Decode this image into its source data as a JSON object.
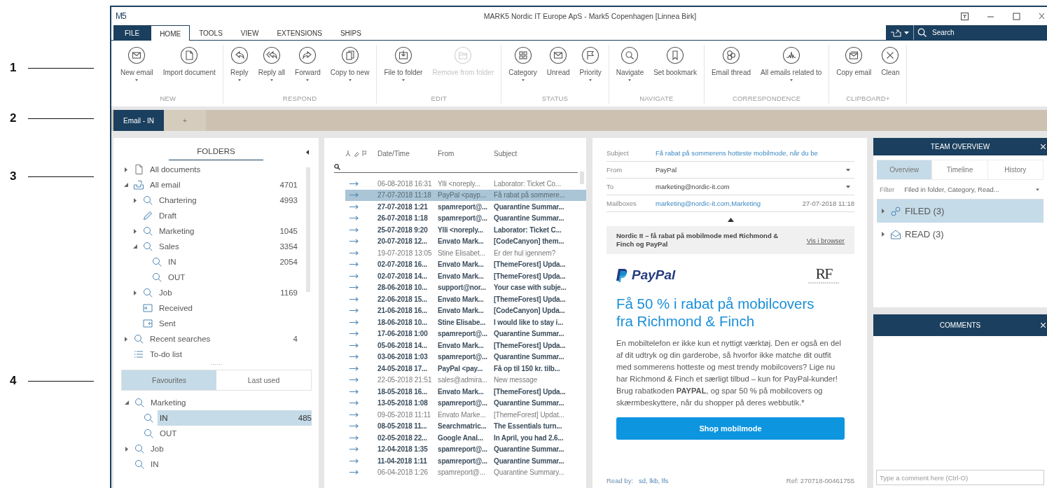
{
  "annotations": [
    {
      "label": "1"
    },
    {
      "label": "2"
    },
    {
      "label": "3"
    },
    {
      "label": "4"
    }
  ],
  "window": {
    "logo": "M5",
    "title": "MARK5 Nordic IT Europe ApS - Mark5 Copenhagen [Linnea Birk]"
  },
  "menu": [
    {
      "label": "FILE",
      "kind": "file",
      "selected": false
    },
    {
      "label": "HOME",
      "kind": "tab",
      "selected": true
    },
    {
      "label": "TOOLS",
      "kind": "tab",
      "selected": false
    },
    {
      "label": "VIEW",
      "kind": "tab",
      "selected": false
    },
    {
      "label": "EXTENSIONS",
      "kind": "tab",
      "selected": false
    },
    {
      "label": "SHIPS",
      "kind": "tab",
      "selected": false
    }
  ],
  "search": {
    "placeholder": "Search"
  },
  "ribbon": [
    {
      "group": "NEW",
      "buttons": [
        {
          "label": "New email",
          "dropdown": true,
          "disabled": false
        },
        {
          "label": "Import document",
          "dropdown": false,
          "disabled": false
        }
      ]
    },
    {
      "group": "RESPOND",
      "buttons": [
        {
          "label": "Reply",
          "dropdown": true,
          "disabled": false
        },
        {
          "label": "Reply all",
          "dropdown": true,
          "disabled": false
        },
        {
          "label": "Forward",
          "dropdown": true,
          "disabled": false
        },
        {
          "label": "Copy to new",
          "dropdown": true,
          "disabled": false
        }
      ]
    },
    {
      "group": "EDIT",
      "buttons": [
        {
          "label": "File to folder",
          "dropdown": true,
          "disabled": false
        },
        {
          "label": "Remove from folder",
          "dropdown": false,
          "disabled": true
        }
      ]
    },
    {
      "group": "STATUS",
      "buttons": [
        {
          "label": "Category",
          "dropdown": true,
          "disabled": false
        },
        {
          "label": "Unread",
          "dropdown": false,
          "disabled": false
        },
        {
          "label": "Priority",
          "dropdown": true,
          "disabled": false
        }
      ]
    },
    {
      "group": "NAVIGATE",
      "buttons": [
        {
          "label": "Navigate",
          "dropdown": true,
          "disabled": false
        },
        {
          "label": "Set bookmark",
          "dropdown": false,
          "disabled": false
        }
      ]
    },
    {
      "group": "CORRESPONDENCE",
      "buttons": [
        {
          "label": "Email thread",
          "dropdown": false,
          "disabled": false
        },
        {
          "label": "All emails related to",
          "dropdown": true,
          "disabled": false
        }
      ]
    },
    {
      "group": "CLIPBOARD+",
      "buttons": [
        {
          "label": "Copy email",
          "dropdown": false,
          "disabled": false
        },
        {
          "label": "Clean",
          "dropdown": false,
          "disabled": false
        }
      ]
    }
  ],
  "doc_tabs": [
    {
      "label": "Email - IN",
      "selected": true
    },
    {
      "label": "+",
      "selected": false
    }
  ],
  "folders": {
    "title": "FOLDERS",
    "items": [
      {
        "label": "All documents",
        "kind": "document",
        "expanded": false
      },
      {
        "label": "All email",
        "kind": "mailbox",
        "count": "4701",
        "expanded": true,
        "children": [
          {
            "label": "Chartering",
            "kind": "search",
            "count": "4993",
            "expanded": false
          },
          {
            "label": "Draft",
            "kind": "draft"
          },
          {
            "label": "Marketing",
            "kind": "search",
            "count": "1045",
            "expanded": false
          },
          {
            "label": "Sales",
            "kind": "search",
            "count": "3354",
            "expanded": true,
            "children": [
              {
                "label": "IN",
                "kind": "search",
                "count": "2054"
              },
              {
                "label": "OUT",
                "kind": "search"
              }
            ]
          },
          {
            "label": "Job",
            "kind": "search",
            "count": "1169",
            "expanded": false
          },
          {
            "label": "Received",
            "kind": "received"
          },
          {
            "label": "Sent",
            "kind": "sent"
          }
        ]
      },
      {
        "label": "Recent searches",
        "kind": "search",
        "count": "4",
        "expanded": false
      },
      {
        "label": "To-do list",
        "kind": "list"
      }
    ],
    "tabs": [
      {
        "label": "Favourites",
        "selected": true
      },
      {
        "label": "Last used",
        "selected": false
      }
    ],
    "favourites": [
      {
        "label": "Marketing",
        "kind": "search",
        "expanded": true,
        "selected": false,
        "children": [
          {
            "label": "IN",
            "kind": "search",
            "count": "485",
            "selected": true
          },
          {
            "label": "OUT",
            "kind": "search",
            "selected": false
          }
        ]
      },
      {
        "label": "Job",
        "kind": "search",
        "expanded": false,
        "selected": false
      },
      {
        "label": "IN",
        "kind": "search",
        "selected": false
      }
    ]
  },
  "mail_list": {
    "columns": [
      "Date/Time",
      "From",
      "Subject"
    ],
    "rows": [
      {
        "date": "06-08-2018 16:31",
        "from": "Ylli <noreply...",
        "subject": "Laborator: Ticket Co...",
        "unread": false,
        "selected": false
      },
      {
        "date": "27-07-2018 11:18",
        "from": "PayPal <payp...",
        "subject": "Få rabat på sommere...",
        "unread": false,
        "selected": true
      },
      {
        "date": "27-07-2018 1:21",
        "from": "spamreport@...",
        "subject": "Quarantine Summar...",
        "unread": true,
        "selected": false
      },
      {
        "date": "26-07-2018 1:18",
        "from": "spamreport@...",
        "subject": "Quarantine Summar...",
        "unread": true,
        "selected": false
      },
      {
        "date": "25-07-2018 9:20",
        "from": "Ylli <noreply...",
        "subject": "Laborator: Ticket C...",
        "unread": true,
        "selected": false
      },
      {
        "date": "20-07-2018 12...",
        "from": "Envato Mark...",
        "subject": "[CodeCanyon] them...",
        "unread": true,
        "selected": false
      },
      {
        "date": "19-07-2018 13:05",
        "from": "Stine Elisabet...",
        "subject": "Er der hul igennem?",
        "unread": false,
        "selected": false
      },
      {
        "date": "02-07-2018 16...",
        "from": "Envato Mark...",
        "subject": "[ThemeForest] Upda...",
        "unread": true,
        "selected": false
      },
      {
        "date": "02-07-2018 14...",
        "from": "Envato Mark...",
        "subject": "[ThemeForest] Upda...",
        "unread": true,
        "selected": false
      },
      {
        "date": "28-06-2018 10...",
        "from": "support@nor...",
        "subject": "Your case with subje...",
        "unread": true,
        "selected": false
      },
      {
        "date": "22-06-2018 15...",
        "from": "Envato Mark...",
        "subject": "[ThemeForest] Upda...",
        "unread": true,
        "selected": false
      },
      {
        "date": "21-06-2018 16...",
        "from": "Envato Mark...",
        "subject": "[CodeCanyon] Upda...",
        "unread": true,
        "selected": false
      },
      {
        "date": "18-06-2018 10...",
        "from": "Stine Elisabe...",
        "subject": "I would like to stay i...",
        "unread": true,
        "selected": false
      },
      {
        "date": "17-06-2018 1:00",
        "from": "spamreport@...",
        "subject": "Quarantine Summar...",
        "unread": true,
        "selected": false
      },
      {
        "date": "05-06-2018 14...",
        "from": "Envato Mark...",
        "subject": "[ThemeForest] Upda...",
        "unread": true,
        "selected": false
      },
      {
        "date": "03-06-2018 1:03",
        "from": "spamreport@...",
        "subject": "Quarantine Summar...",
        "unread": true,
        "selected": false
      },
      {
        "date": "24-05-2018 17...",
        "from": "PayPal <pay...",
        "subject": "Få op til 150 kr. tilb...",
        "unread": true,
        "selected": false
      },
      {
        "date": "22-05-2018 21:51",
        "from": "sales@admira...",
        "subject": "New message",
        "unread": false,
        "selected": false
      },
      {
        "date": "18-05-2018 16...",
        "from": "Envato Mark...",
        "subject": "[ThemeForest] Upda...",
        "unread": true,
        "selected": false
      },
      {
        "date": "13-05-2018 1:08",
        "from": "spamreport@...",
        "subject": "Quarantine Summar...",
        "unread": true,
        "selected": false
      },
      {
        "date": "09-05-2018 11:11",
        "from": "Envato Marke...",
        "subject": "[ThemeForest] Updat...",
        "unread": false,
        "selected": false
      },
      {
        "date": "08-05-2018 11...",
        "from": "Searchmatric...",
        "subject": "The Essentials turn...",
        "unread": true,
        "selected": false
      },
      {
        "date": "02-05-2018 22...",
        "from": "Google Anal...",
        "subject": "In April, you had 2.6...",
        "unread": true,
        "selected": false
      },
      {
        "date": "12-04-2018 1:35",
        "from": "spamreport@...",
        "subject": "Quarantine Summar...",
        "unread": true,
        "selected": false
      },
      {
        "date": "11-04-2018 1:11",
        "from": "spamreport@...",
        "subject": "Quarantine Summar...",
        "unread": true,
        "selected": false
      },
      {
        "date": "06-04-2018 1:26",
        "from": "spamreport@...",
        "subject": "Quarantine Summary...",
        "unread": false,
        "selected": false
      }
    ]
  },
  "reader": {
    "fields": [
      {
        "label": "Subject",
        "value": "Få rabat på sommerens hotteste mobilmode, når du be",
        "kind": "link"
      },
      {
        "label": "From",
        "value": "PayPal",
        "kind": "dropdown"
      },
      {
        "label": "To",
        "value": "marketing@nordic-it.com",
        "kind": "dropdown"
      },
      {
        "label": "Mailboxes",
        "value": "marketing@nordic-it.com,Marketing",
        "kind": "link",
        "date": "27-07-2018 11:18"
      }
    ],
    "banner": {
      "text": "Nordic It – få rabat på mobilmode med Richmond & Finch og PayPal",
      "link": "Vis i browser"
    },
    "brand": "PayPal",
    "partner_logo": "RF",
    "heading": "Få 50 % i rabat på mobilcovers fra Richmond & Finch",
    "paragraph": "En mobiltelefon er ikke kun et nyttigt værktøj. Den er også en del af dit udtryk og din garderobe, så hvorfor ikke matche dit outfit med sommerens hotteste og mest trendy mobilcovers? Lige nu har Richmond & Finch et særligt tilbud – kun for PayPal-kunder! Brug rabatkoden **PAYPAL**, og spar 50 % på mobilcovers og skærmbeskyttere, når du shopper på deres webbutik.*",
    "button": "Shop mobilmode",
    "read_by": {
      "label": "Read by:",
      "value": "sd, lkb, lfs"
    },
    "ref": "Ref: 270718-00461755"
  },
  "team": {
    "title": "TEAM OVERVIEW",
    "tabs": [
      {
        "label": "Overview",
        "selected": true
      },
      {
        "label": "Timeline",
        "selected": false
      },
      {
        "label": "History",
        "selected": false
      }
    ],
    "filter": {
      "label": "Filter",
      "value": "Filed in folder, Category, Read..."
    },
    "items": [
      {
        "label": "FILED (3)",
        "kind": "filed",
        "expanded": false,
        "selected": true
      },
      {
        "label": "READ (3)",
        "kind": "read",
        "expanded": false,
        "selected": false
      }
    ]
  },
  "comments": {
    "title": "COMMENTS",
    "placeholder": "Type a comment here (Ctrl-O)"
  }
}
